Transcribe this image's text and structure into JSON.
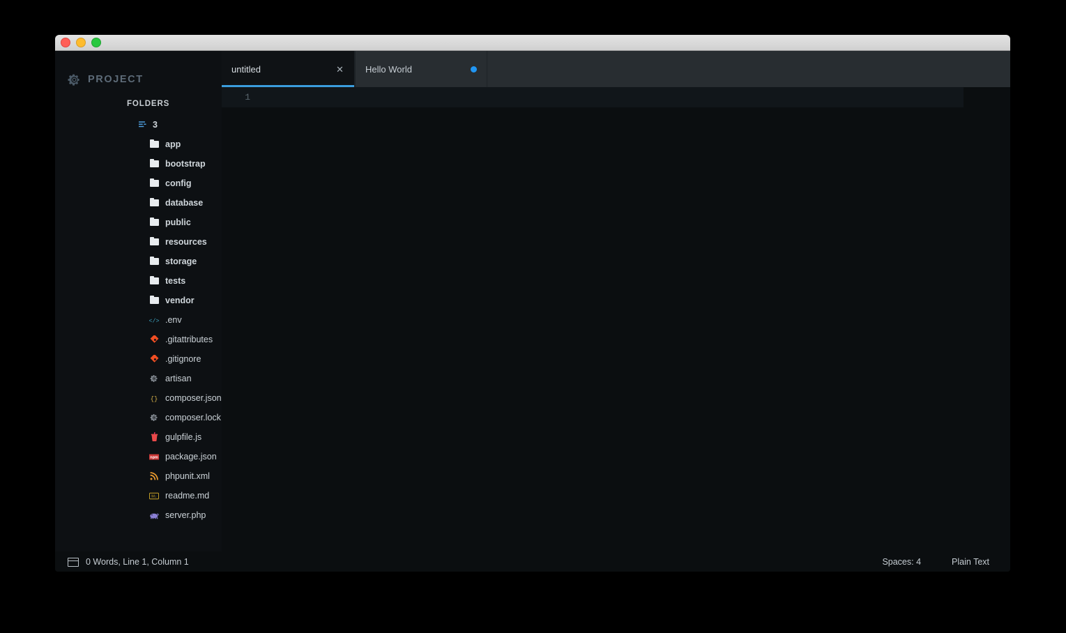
{
  "window": {
    "controls": [
      {
        "name": "close",
        "color": "#ff5f57"
      },
      {
        "name": "minimize",
        "color": "#febc2e"
      },
      {
        "name": "maximize",
        "color": "#28c840"
      }
    ]
  },
  "sidebar": {
    "project_title": "PROJECT",
    "project_icon": "gear-icon",
    "folders_label": "FOLDERS",
    "root": {
      "label": "3",
      "icon": "project-settings-icon"
    },
    "items": [
      {
        "label": "app",
        "type": "dir",
        "icon": "folder-icon"
      },
      {
        "label": "bootstrap",
        "type": "dir",
        "icon": "folder-icon"
      },
      {
        "label": "config",
        "type": "dir",
        "icon": "folder-icon"
      },
      {
        "label": "database",
        "type": "dir",
        "icon": "folder-icon"
      },
      {
        "label": "public",
        "type": "dir",
        "icon": "folder-icon"
      },
      {
        "label": "resources",
        "type": "dir",
        "icon": "folder-icon"
      },
      {
        "label": "storage",
        "type": "dir",
        "icon": "folder-icon"
      },
      {
        "label": "tests",
        "type": "dir",
        "icon": "folder-icon"
      },
      {
        "label": "vendor",
        "type": "dir",
        "icon": "folder-icon"
      },
      {
        "label": ".env",
        "type": "file",
        "icon": "code-tags-icon",
        "color": "#3fa7c4"
      },
      {
        "label": ".gitattributes",
        "type": "file",
        "icon": "git-icon",
        "color": "#f04e23"
      },
      {
        "label": ".gitignore",
        "type": "file",
        "icon": "git-icon",
        "color": "#f04e23"
      },
      {
        "label": "artisan",
        "type": "file",
        "icon": "gear-small-icon",
        "color": "#8a9199"
      },
      {
        "label": "composer.json",
        "type": "file",
        "icon": "braces-icon",
        "color": "#d8b24a"
      },
      {
        "label": "composer.lock",
        "type": "file",
        "icon": "gear-small-icon",
        "color": "#8a9199"
      },
      {
        "label": "gulpfile.js",
        "type": "file",
        "icon": "gulp-cup-icon",
        "color": "#e94a4a"
      },
      {
        "label": "package.json",
        "type": "file",
        "icon": "npm-icon",
        "color": "#cb3837"
      },
      {
        "label": "phpunit.xml",
        "type": "file",
        "icon": "rss-icon",
        "color": "#e8992e"
      },
      {
        "label": "readme.md",
        "type": "file",
        "icon": "markdown-icon",
        "color": "#c9a227"
      },
      {
        "label": "server.php",
        "type": "file",
        "icon": "php-elephant-icon",
        "color": "#8a7fd4"
      }
    ]
  },
  "tabs": [
    {
      "label": "untitled",
      "active": true,
      "indicator": "close-icon"
    },
    {
      "label": "Hello World",
      "active": false,
      "indicator": "modified-dot"
    }
  ],
  "editor": {
    "line_numbers": [
      "1"
    ],
    "content": "",
    "active_line_color": "#11161a",
    "accent_color": "#3b9ddd"
  },
  "statusbar": {
    "layout_icon": "panes-icon",
    "left_text": "0 Words, Line 1, Column 1",
    "spaces": "Spaces: 4",
    "syntax": "Plain Text"
  }
}
